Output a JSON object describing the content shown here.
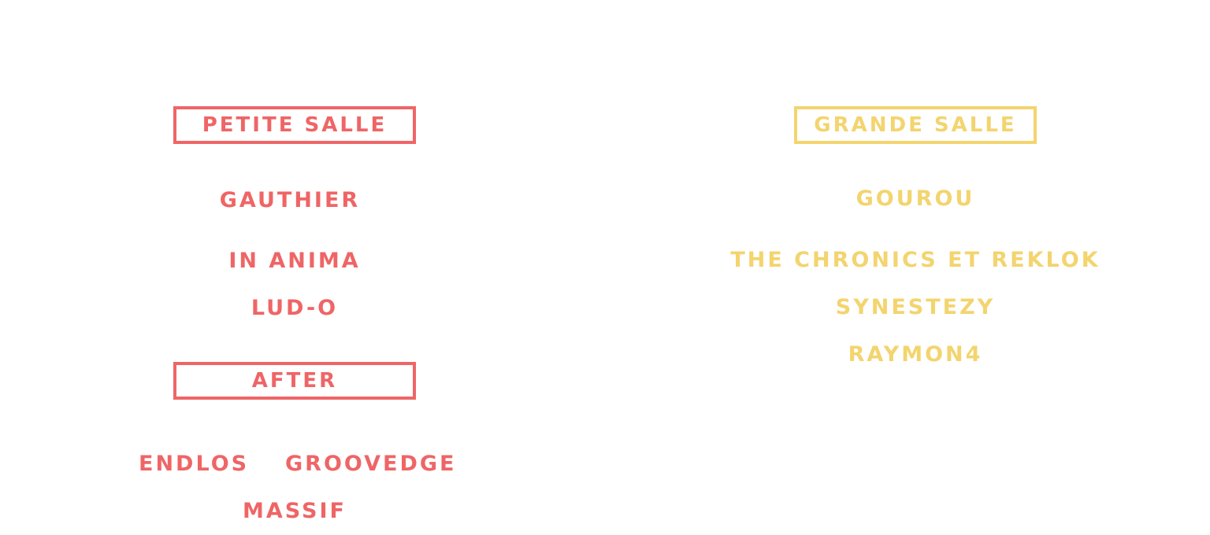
{
  "colors": {
    "petite": "#ef6566",
    "grande": "#f3d46e"
  },
  "petite_salle": {
    "heading": "PETITE SALLE",
    "acts": [
      "GAUTHIER",
      "IN ANIMA",
      "LUD-O"
    ]
  },
  "after": {
    "heading": "AFTER",
    "acts": [
      "ENDLOS",
      "GROOVEDGE",
      "MASSIF"
    ]
  },
  "grande_salle": {
    "heading": "GRANDE SALLE",
    "acts": [
      "GOUROU",
      "THE CHRONICS ET REKLOK",
      "SYNESTEZY",
      "RAYMON4"
    ]
  }
}
